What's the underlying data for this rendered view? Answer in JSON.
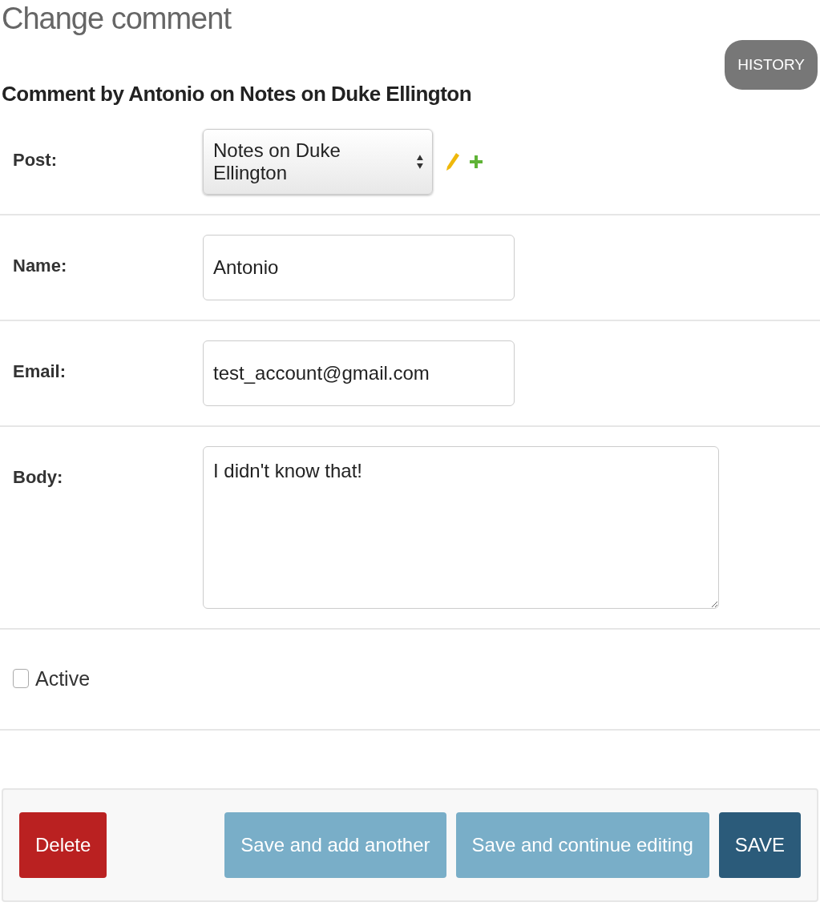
{
  "page_title": "Change comment",
  "history_button": "HISTORY",
  "subtitle": "Comment by Antonio on Notes on Duke Ellington",
  "fields": [
    {
      "kind": "select",
      "label": "Post:",
      "value": "Notes on Duke Ellington"
    },
    {
      "kind": "text",
      "label": "Name:",
      "value": "Antonio"
    },
    {
      "kind": "text",
      "label": "Email:",
      "value": "test_account@gmail.com"
    },
    {
      "kind": "textarea",
      "label": "Body:",
      "value": "I didn't know that!"
    },
    {
      "kind": "checkbox",
      "label": "Active",
      "checked": false
    }
  ],
  "delete_button": "Delete",
  "buttons": [
    {
      "kind": "secondary",
      "label": "Save and add another"
    },
    {
      "kind": "secondary",
      "label": "Save and continue editing"
    },
    {
      "kind": "primary",
      "label": "SAVE"
    }
  ]
}
